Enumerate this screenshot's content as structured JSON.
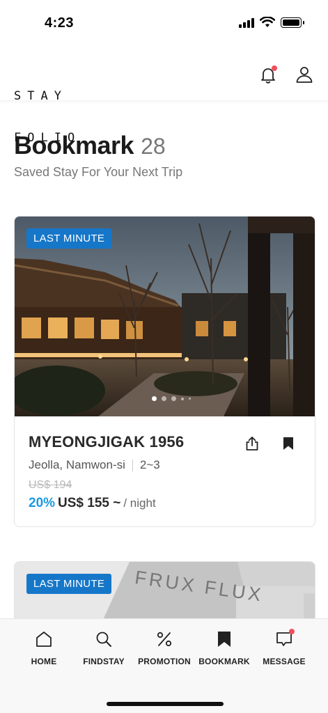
{
  "status_bar": {
    "time": "4:23"
  },
  "header": {
    "logo_line1": "STAY",
    "logo_line2": "FOLIO",
    "notification_dot_color": "#f0505c"
  },
  "page": {
    "title": "Bookmark",
    "count": "28",
    "subtitle": "Saved Stay For Your Next Trip"
  },
  "cards": [
    {
      "badge": "LAST MINUTE",
      "name": "MYEONGJIGAK 1956",
      "location": "Jeolla, Namwon-si",
      "guests": "2~3",
      "original_price": "US$ 194",
      "discount": "20%",
      "price": "US$ 155 ~",
      "per": "/ night",
      "photo_index": 1,
      "photo_count": 5
    },
    {
      "badge": "LAST MINUTE",
      "photo_sign": "FRUX FLUX"
    }
  ],
  "colors": {
    "badge": "#1677c9",
    "discount": "#1a9be0",
    "accent_dot": "#f0505c"
  },
  "bottom_nav": {
    "home": "HOME",
    "findstay": "FINDSTAY",
    "promotion": "PROMOTION",
    "bookmark": "BOOKMARK",
    "message": "MESSAGE"
  }
}
